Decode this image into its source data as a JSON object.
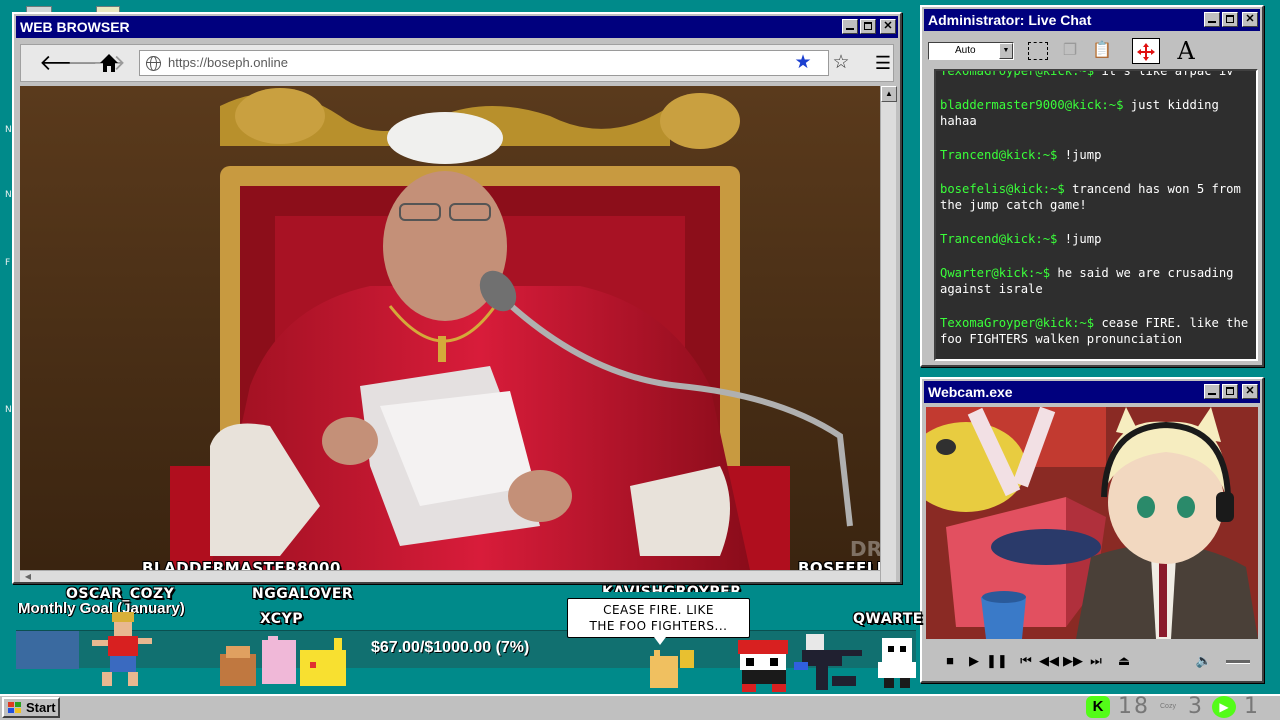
{
  "desktop": {
    "side_letters": [
      "N",
      "N",
      "F",
      "N"
    ]
  },
  "browser": {
    "title": "WEB BROWSER",
    "url": "https://boseph.online",
    "overlay_left": "BLADDERMASTER8000",
    "overlay_right": "BOSEFELIS"
  },
  "chat": {
    "title": "Administrator: Live Chat",
    "font_select": "Auto",
    "messages": [
      {
        "user": "TexomaGroyper@kick:~$",
        "text": "it's like afpac iv"
      },
      {
        "user": "bladdermaster9000@kick:~$",
        "text": "just kidding hahaa"
      },
      {
        "user": "Trancend@kick:~$",
        "text": "!jump"
      },
      {
        "user": "bosefelis@kick:~$",
        "text": "trancend has won 5 from the jump catch game!"
      },
      {
        "user": "Trancend@kick:~$",
        "text": "!jump"
      },
      {
        "user": "Qwarter@kick:~$",
        "text": "he said we are crusading against israle"
      },
      {
        "user": "TexomaGroyper@kick:~$",
        "text": "cease FIRE. like the foo FIGHTERS walken pronunciation"
      }
    ]
  },
  "webcam": {
    "title": "Webcam.exe"
  },
  "overlay": {
    "goal_label": "Monthly Goal (January)",
    "goal_text": "$67.00/$1000.00 (7%)",
    "goal_progress": 0.07,
    "names": {
      "oscar": "OSCAR_COZY",
      "nggalover": "NGGALOVER",
      "xcyp": "XCYP",
      "kavish": "KAVISHGROYPER",
      "qwarte": "QWARTE"
    },
    "bubble_line1": "CEASE FIRE. LIKE",
    "bubble_line2": "THE FOO FIGHTERS..."
  },
  "taskbar": {
    "start_label": "Start",
    "tray_n1": "1",
    "tray_n2": "8",
    "tray_small": "Cozy",
    "tray_n3": "3",
    "tray_n4": "1"
  }
}
